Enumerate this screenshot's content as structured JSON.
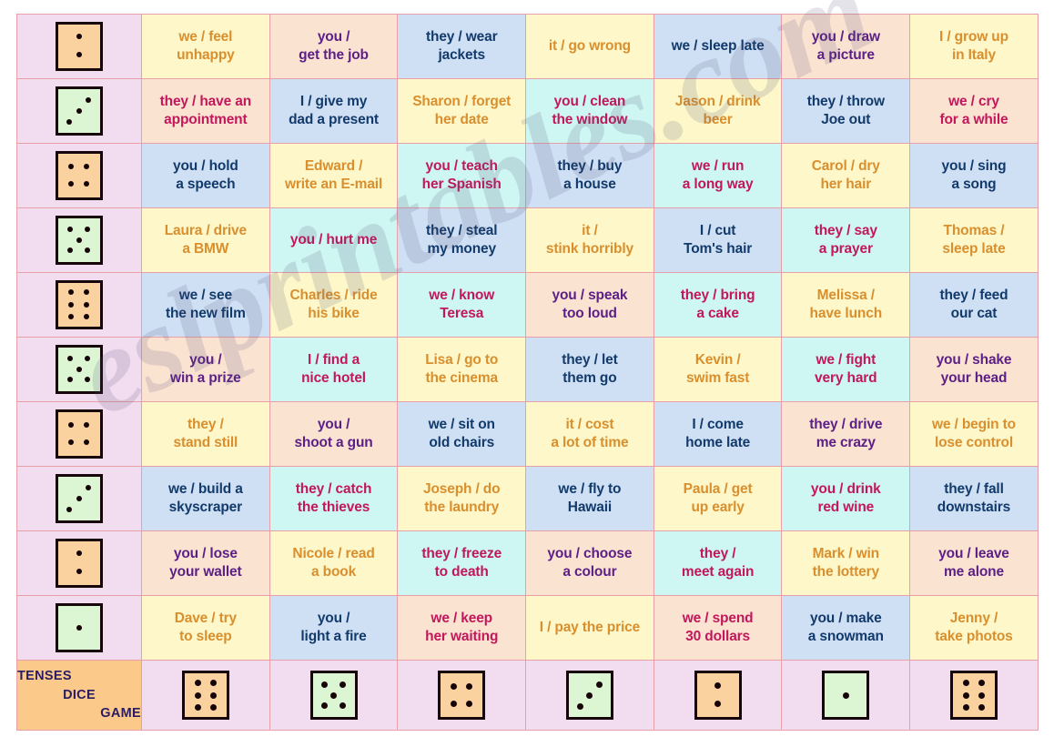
{
  "title": {
    "line1": "TENSES",
    "line2": "DICE",
    "line3": "GAME"
  },
  "watermark": "eslprintables.com",
  "colors": {
    "lilac": "#f2dcef",
    "cream": "#fdf7c9",
    "peach": "#fbe3d2",
    "blue": "#cfe0f5",
    "cyan": "#cef6f2",
    "orange": "#fad2a0",
    "die_green": "#dcf5d2",
    "text_orange": "#d98f2e",
    "text_purple": "#5b1f86",
    "text_navy": "#123a6b",
    "text_magenta": "#c2185b",
    "title_text": "#2b1b63",
    "grid_line": "#e8a0a8"
  },
  "grid": {
    "columns": 8,
    "rows": 11,
    "row_dice": [
      {
        "value": 2,
        "colour": "orange"
      },
      {
        "value": 3,
        "colour": "green"
      },
      {
        "value": 4,
        "colour": "orange"
      },
      {
        "value": 5,
        "colour": "green"
      },
      {
        "value": 6,
        "colour": "orange"
      },
      {
        "value": 5,
        "colour": "green"
      },
      {
        "value": 4,
        "colour": "orange"
      },
      {
        "value": 3,
        "colour": "green"
      },
      {
        "value": 2,
        "colour": "orange"
      },
      {
        "value": 1,
        "colour": "green"
      }
    ],
    "column_dice": [
      {
        "value": 6,
        "colour": "orange"
      },
      {
        "value": 5,
        "colour": "green"
      },
      {
        "value": 4,
        "colour": "orange"
      },
      {
        "value": 3,
        "colour": "green"
      },
      {
        "value": 2,
        "colour": "orange"
      },
      {
        "value": 1,
        "colour": "green"
      },
      {
        "value": 6,
        "colour": "orange"
      }
    ],
    "cells": [
      [
        {
          "text": "we / feel\nunhappy",
          "bg": "cream",
          "tx": "orange"
        },
        {
          "text": "you /\nget the job",
          "bg": "peach",
          "tx": "purple"
        },
        {
          "text": "they / wear\njackets",
          "bg": "blue",
          "tx": "navy"
        },
        {
          "text": "it / go wrong",
          "bg": "cream",
          "tx": "orange"
        },
        {
          "text": "we / sleep late",
          "bg": "blue",
          "tx": "navy"
        },
        {
          "text": "you / draw\na picture",
          "bg": "peach",
          "tx": "purple"
        },
        {
          "text": "I / grow up\nin Italy",
          "bg": "cream",
          "tx": "orange"
        }
      ],
      [
        {
          "text": "they / have an\nappointment",
          "bg": "peach",
          "tx": "magenta"
        },
        {
          "text": "I / give my\ndad a  present",
          "bg": "blue",
          "tx": "navy"
        },
        {
          "text": "Sharon / forget\nher date",
          "bg": "cream",
          "tx": "orange"
        },
        {
          "text": "you / clean\nthe window",
          "bg": "cyan",
          "tx": "magenta"
        },
        {
          "text": "Jason /  drink\nbeer",
          "bg": "cream",
          "tx": "orange"
        },
        {
          "text": "they / throw\nJoe out",
          "bg": "blue",
          "tx": "navy"
        },
        {
          "text": "we / cry\nfor a while",
          "bg": "peach",
          "tx": "magenta"
        }
      ],
      [
        {
          "text": "you / hold\na speech",
          "bg": "blue",
          "tx": "navy"
        },
        {
          "text": "Edward /\nwrite an E-mail",
          "bg": "cream",
          "tx": "orange"
        },
        {
          "text": "you / teach\nher Spanish",
          "bg": "cyan",
          "tx": "magenta"
        },
        {
          "text": "they / buy\na house",
          "bg": "blue",
          "tx": "navy"
        },
        {
          "text": "we / run\na long way",
          "bg": "cyan",
          "tx": "magenta"
        },
        {
          "text": "Carol / dry\nher hair",
          "bg": "cream",
          "tx": "orange"
        },
        {
          "text": "you / sing\na song",
          "bg": "blue",
          "tx": "navy"
        }
      ],
      [
        {
          "text": "Laura / drive\na BMW",
          "bg": "cream",
          "tx": "orange"
        },
        {
          "text": "you / hurt me",
          "bg": "cyan",
          "tx": "magenta"
        },
        {
          "text": "they / steal\nmy money",
          "bg": "blue",
          "tx": "navy"
        },
        {
          "text": "it /\nstink horribly",
          "bg": "cream",
          "tx": "orange"
        },
        {
          "text": "I / cut\nTom's hair",
          "bg": "blue",
          "tx": "navy"
        },
        {
          "text": "they / say\na prayer",
          "bg": "cyan",
          "tx": "magenta"
        },
        {
          "text": "Thomas /\nsleep late",
          "bg": "cream",
          "tx": "orange"
        }
      ],
      [
        {
          "text": "we / see\nthe new film",
          "bg": "blue",
          "tx": "navy"
        },
        {
          "text": "Charles / ride\nhis bike",
          "bg": "cream",
          "tx": "orange"
        },
        {
          "text": "we / know\nTeresa",
          "bg": "cyan",
          "tx": "magenta"
        },
        {
          "text": "you / speak\ntoo loud",
          "bg": "peach",
          "tx": "purple"
        },
        {
          "text": "they / bring\na cake",
          "bg": "cyan",
          "tx": "magenta"
        },
        {
          "text": "Melissa /\nhave lunch",
          "bg": "cream",
          "tx": "orange"
        },
        {
          "text": "they / feed\nour cat",
          "bg": "blue",
          "tx": "navy"
        }
      ],
      [
        {
          "text": "you /\nwin a prize",
          "bg": "peach",
          "tx": "purple"
        },
        {
          "text": "I / find a\nnice hotel",
          "bg": "cyan",
          "tx": "magenta"
        },
        {
          "text": "Lisa / go to\nthe cinema",
          "bg": "cream",
          "tx": "orange"
        },
        {
          "text": "they / let\nthem go",
          "bg": "blue",
          "tx": "navy"
        },
        {
          "text": "Kevin /\nswim fast",
          "bg": "cream",
          "tx": "orange"
        },
        {
          "text": "we / fight\nvery hard",
          "bg": "cyan",
          "tx": "magenta"
        },
        {
          "text": "you / shake\nyour head",
          "bg": "peach",
          "tx": "purple"
        }
      ],
      [
        {
          "text": "they /\nstand still",
          "bg": "cream",
          "tx": "orange"
        },
        {
          "text": "you /\nshoot a gun",
          "bg": "peach",
          "tx": "purple"
        },
        {
          "text": "we / sit on\nold chairs",
          "bg": "blue",
          "tx": "navy"
        },
        {
          "text": "it / cost\na lot of time",
          "bg": "cream",
          "tx": "orange"
        },
        {
          "text": "I / come\nhome late",
          "bg": "blue",
          "tx": "navy"
        },
        {
          "text": "they / drive\nme crazy",
          "bg": "peach",
          "tx": "purple"
        },
        {
          "text": "we / begin to\nlose control",
          "bg": "cream",
          "tx": "orange"
        }
      ],
      [
        {
          "text": "we / build a\nskyscraper",
          "bg": "blue",
          "tx": "navy"
        },
        {
          "text": "they / catch\nthe thieves",
          "bg": "cyan",
          "tx": "magenta"
        },
        {
          "text": "Joseph / do\nthe laundry",
          "bg": "cream",
          "tx": "orange"
        },
        {
          "text": "we / fly to\nHawaii",
          "bg": "blue",
          "tx": "navy"
        },
        {
          "text": "Paula / get\nup early",
          "bg": "cream",
          "tx": "orange"
        },
        {
          "text": "you / drink\nred wine",
          "bg": "cyan",
          "tx": "magenta"
        },
        {
          "text": "they / fall\ndownstairs",
          "bg": "blue",
          "tx": "navy"
        }
      ],
      [
        {
          "text": "you / lose\nyour wallet",
          "bg": "peach",
          "tx": "purple"
        },
        {
          "text": "Nicole / read\na book",
          "bg": "cream",
          "tx": "orange"
        },
        {
          "text": "they / freeze\nto death",
          "bg": "cyan",
          "tx": "magenta"
        },
        {
          "text": "you / choose\na colour",
          "bg": "peach",
          "tx": "purple"
        },
        {
          "text": "they /\nmeet again",
          "bg": "cyan",
          "tx": "magenta"
        },
        {
          "text": "Mark / win\nthe lottery",
          "bg": "cream",
          "tx": "orange"
        },
        {
          "text": "you / leave\nme alone",
          "bg": "peach",
          "tx": "purple"
        }
      ],
      [
        {
          "text": "Dave / try\nto sleep",
          "bg": "cream",
          "tx": "orange"
        },
        {
          "text": "you /\nlight a fire",
          "bg": "blue",
          "tx": "navy"
        },
        {
          "text": "we / keep\nher waiting",
          "bg": "peach",
          "tx": "magenta"
        },
        {
          "text": "I / pay the price",
          "bg": "cream",
          "tx": "orange"
        },
        {
          "text": "we / spend\n30 dollars",
          "bg": "peach",
          "tx": "magenta"
        },
        {
          "text": "you / make\na snowman",
          "bg": "blue",
          "tx": "navy"
        },
        {
          "text": "Jenny /\ntake photos",
          "bg": "cream",
          "tx": "orange"
        }
      ]
    ]
  }
}
